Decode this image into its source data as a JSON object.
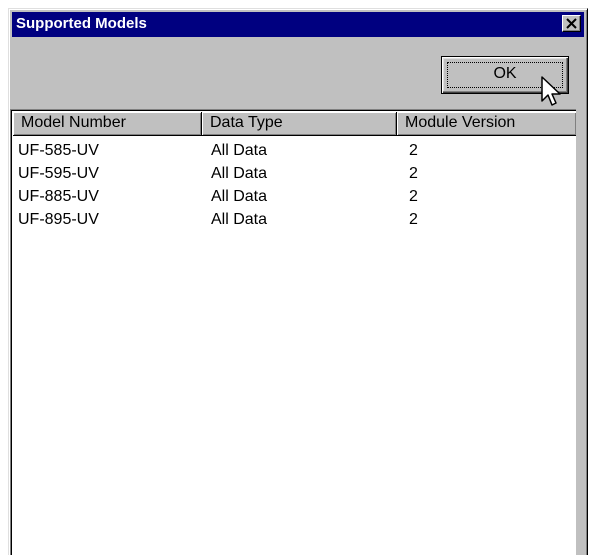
{
  "window": {
    "title": "Supported Models",
    "close_icon": "close-icon"
  },
  "ok_button": {
    "label": "OK"
  },
  "list": {
    "columns": [
      "Model Number",
      "Data Type",
      "Module Version"
    ],
    "rows": [
      [
        "UF-585-UV",
        "All Data",
        "2"
      ],
      [
        "UF-595-UV",
        "All Data",
        "2"
      ],
      [
        "UF-885-UV",
        "All Data",
        "2"
      ],
      [
        "UF-895-UV",
        "All Data",
        "2"
      ]
    ]
  },
  "colors": {
    "title_bar": "#000080",
    "face": "#c0c0c0"
  }
}
